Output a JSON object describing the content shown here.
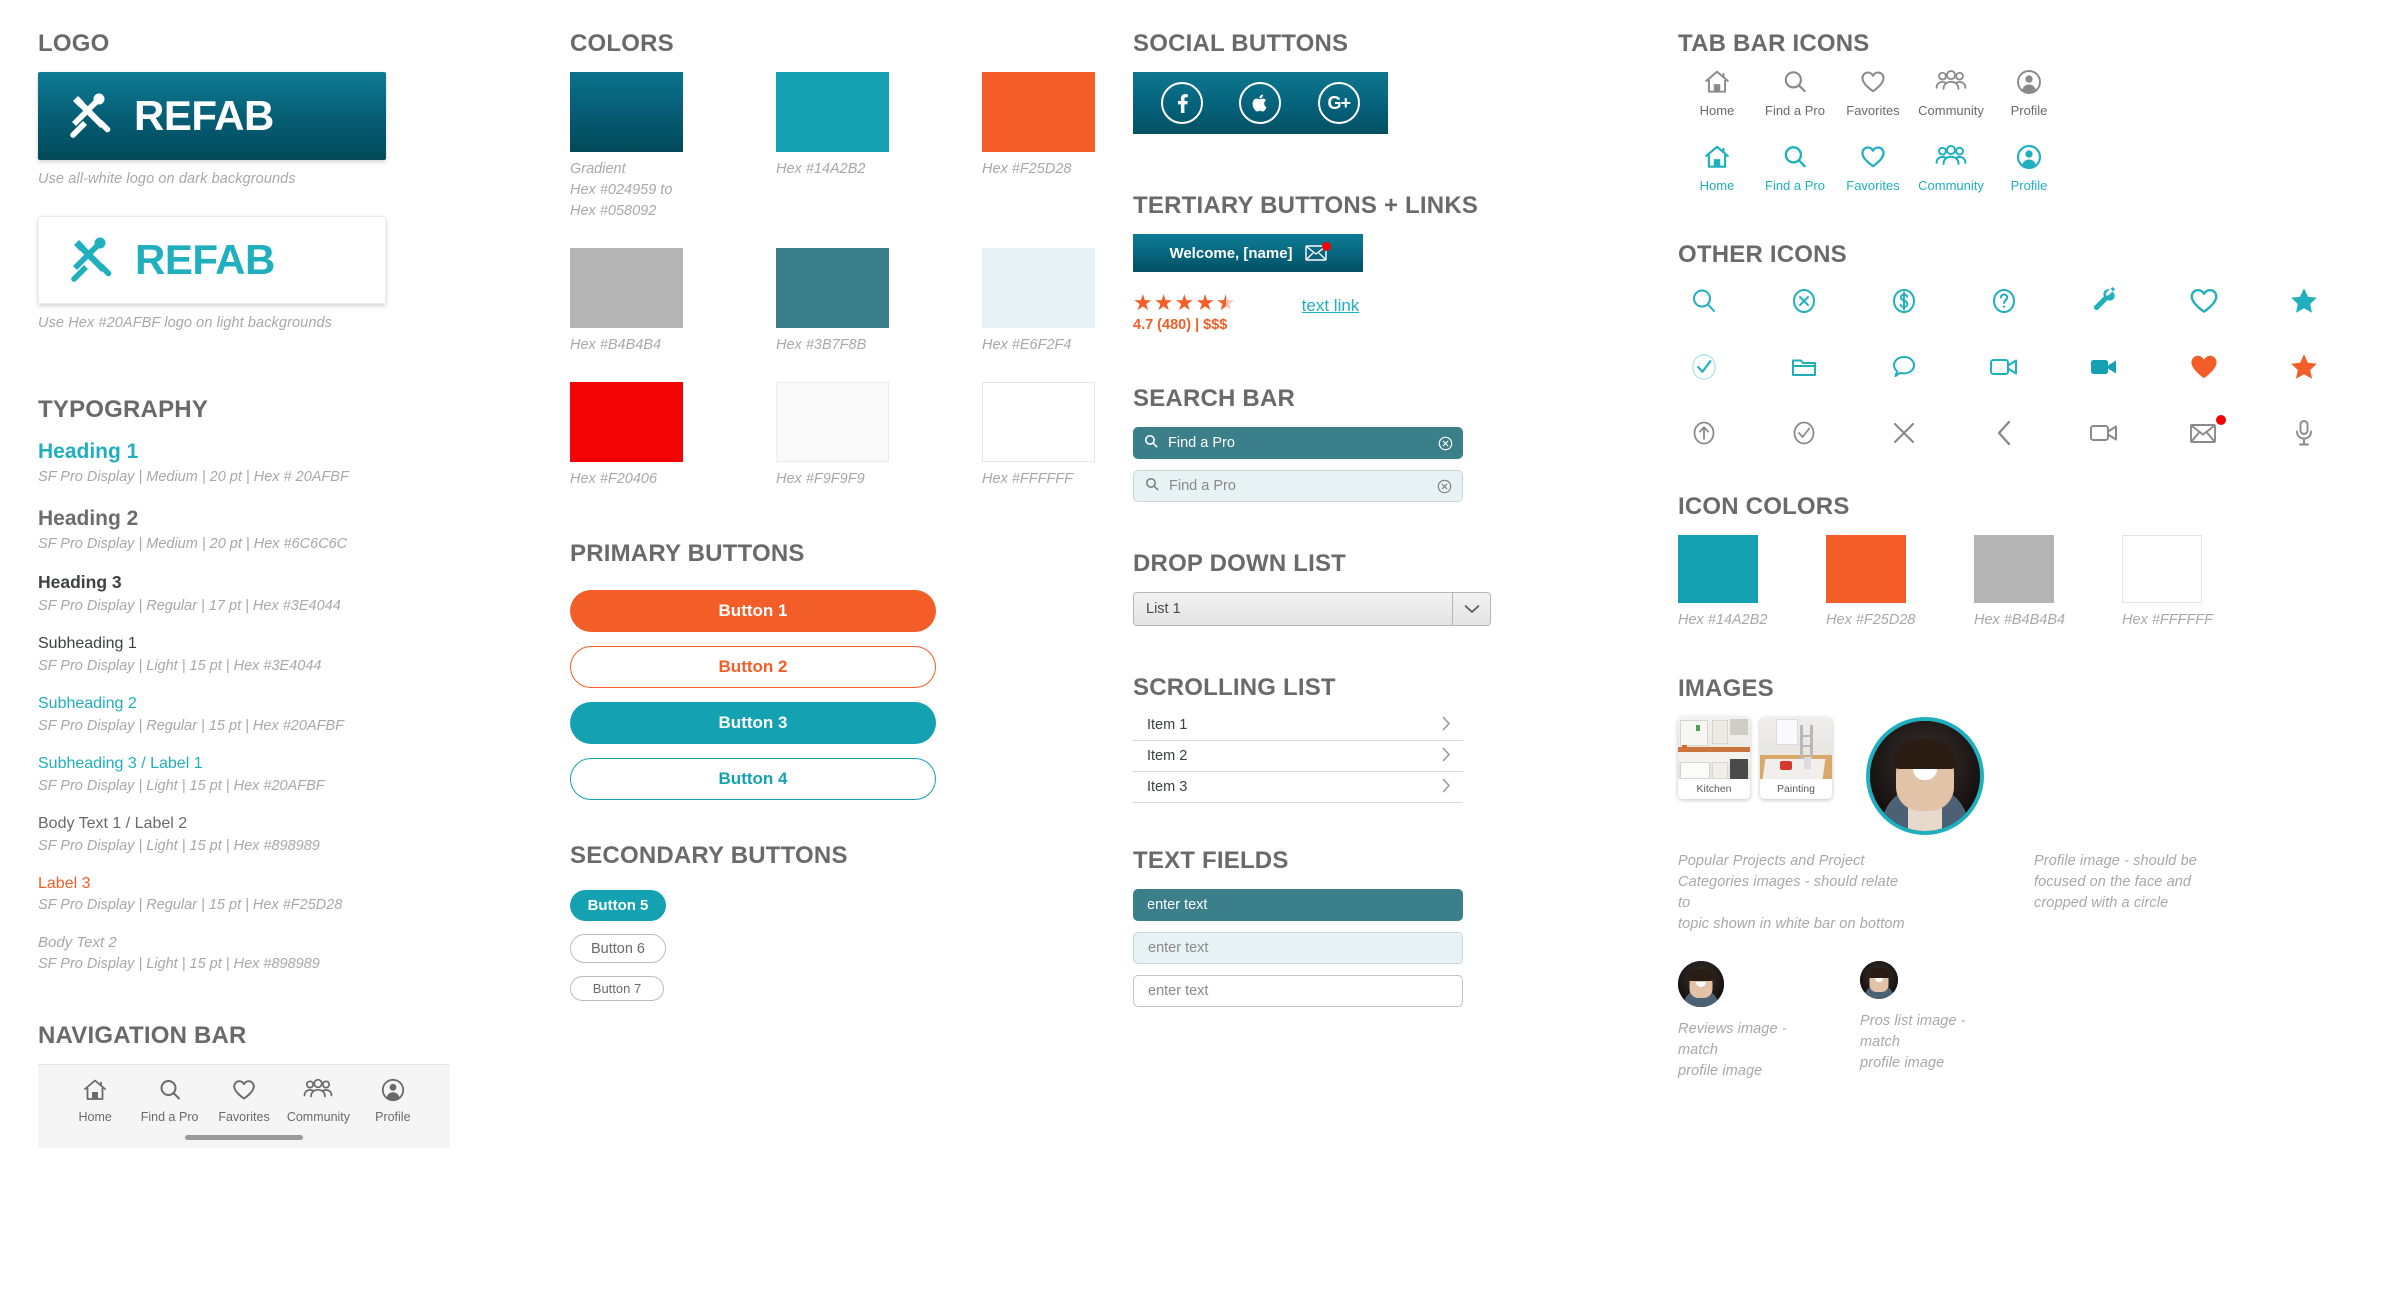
{
  "logo": {
    "title": "LOGO",
    "wordmark": "REFAB",
    "dark_caption": "Use all-white logo on dark backgrounds",
    "light_caption": "Use  Hex #20AFBF logo on light backgrounds",
    "dark_gradient_from": "#058092",
    "dark_gradient_to": "#024959",
    "light_color": "#20AFBF"
  },
  "typography": {
    "title": "TYPOGRAPHY",
    "rows": [
      {
        "name": "Heading 1",
        "spec": "SF Pro Display | Medium | 20 pt | Hex # 20AFBF",
        "color": "#20AFBF"
      },
      {
        "name": "Heading 2",
        "spec": "SF Pro Display | Medium | 20  pt | Hex #6C6C6C",
        "color": "#6C6C6C"
      },
      {
        "name": "Heading 3",
        "spec": "SF Pro Display | Regular | 17 pt | Hex #3E4044",
        "color": "#3E4044"
      },
      {
        "name": "Subheading 1",
        "spec": "SF Pro Display | Light | 15 pt | Hex #3E4044",
        "color": "#3E4044"
      },
      {
        "name": "Subheading 2",
        "spec": "SF Pro Display | Regular | 15 pt | Hex #20AFBF",
        "color": "#20AFBF"
      },
      {
        "name": "Subheading 3 / Label 1",
        "spec": "SF Pro Display | Light | 15 pt | Hex #20AFBF",
        "color": "#20AFBF"
      },
      {
        "name": "Body Text 1 / Label 2",
        "spec": "SF Pro Display | Light | 15 pt | Hex #898989",
        "color": "#898989"
      },
      {
        "name": "Label 3",
        "spec": "SF Pro Display | Regular | 15 pt | Hex #F25D28",
        "color": "#F25D28"
      },
      {
        "name": "Body Text 2",
        "spec": "SF Pro Display | Light | 15 pt | Hex #898989",
        "color": "#898989"
      }
    ]
  },
  "navigation_bar": {
    "title": "NAVIGATION BAR",
    "items": [
      {
        "label": "Home",
        "icon": "home-icon"
      },
      {
        "label": "Find a Pro",
        "icon": "search-icon"
      },
      {
        "label": "Favorites",
        "icon": "heart-icon"
      },
      {
        "label": "Community",
        "icon": "community-icon"
      },
      {
        "label": "Profile",
        "icon": "profile-icon"
      }
    ]
  },
  "colors": {
    "title": "COLORS",
    "swatches": [
      {
        "label": "Gradient\nHex #024959 to\nHex #058092",
        "hex": "gradient",
        "from": "#058092",
        "to": "#024959"
      },
      {
        "label": "Hex #14A2B2",
        "hex": "#14A2B2"
      },
      {
        "label": "Hex #F25D28",
        "hex": "#F25D28"
      },
      {
        "label": "Hex #B4B4B4",
        "hex": "#B4B4B4"
      },
      {
        "label": "Hex #3B7F8B",
        "hex": "#3B7F8B"
      },
      {
        "label": "Hex #E6F2F4",
        "hex": "#E6F2F4"
      },
      {
        "label": "Hex #F20406",
        "hex": "#F20406"
      },
      {
        "label": "Hex #F9F9F9",
        "hex": "#F9F9F9"
      },
      {
        "label": "Hex #FFFFFF",
        "hex": "#FFFFFF"
      }
    ]
  },
  "primary_buttons": {
    "title": "PRIMARY BUTTONS",
    "buttons": [
      {
        "label": "Button 1",
        "style": "filled-orange"
      },
      {
        "label": "Button 2",
        "style": "outline-orange"
      },
      {
        "label": "Button 3",
        "style": "filled-teal"
      },
      {
        "label": "Button 4",
        "style": "outline-teal"
      }
    ]
  },
  "secondary_buttons": {
    "title": "SECONDARY BUTTONS",
    "buttons": [
      {
        "label": "Button 5",
        "style": "filled-teal-sm"
      },
      {
        "label": "Button 6",
        "style": "outline-grey-md"
      },
      {
        "label": "Button 7",
        "style": "outline-grey-sm"
      }
    ]
  },
  "social_buttons": {
    "title": "SOCIAL BUTTONS",
    "items": [
      {
        "icon": "facebook-icon",
        "label": "f"
      },
      {
        "icon": "apple-icon",
        "label": ""
      },
      {
        "icon": "google-plus-icon",
        "label": "G+"
      }
    ]
  },
  "tertiary": {
    "title": "TERTIARY BUTTONS + LINKS",
    "welcome_label": "Welcome, [name]",
    "mail_icon": "envelope-icon",
    "rating_value": "4.7 (480)  |  $$$",
    "stars_filled": 4,
    "stars_half": 1,
    "link_label": "text link"
  },
  "search_bar": {
    "title": "SEARCH BAR",
    "fields": [
      {
        "placeholder": "Find a Pro",
        "style": "dark"
      },
      {
        "placeholder": "Find a Pro",
        "style": "light"
      }
    ]
  },
  "dropdown": {
    "title": "DROP DOWN LIST",
    "selected": "List 1"
  },
  "scrolling_list": {
    "title": "SCROLLING LIST",
    "items": [
      "Item 1",
      "Item 2",
      "Item 3"
    ]
  },
  "text_fields": {
    "title": "TEXT FIELDS",
    "fields": [
      {
        "placeholder": "enter text",
        "style": "dark"
      },
      {
        "placeholder": "enter text",
        "style": "light"
      },
      {
        "placeholder": "enter text",
        "style": "white"
      }
    ]
  },
  "tab_bar_icons": {
    "title": "TAB BAR ICONS",
    "grey_row": [
      {
        "label": "Home",
        "icon": "home-icon"
      },
      {
        "label": "Find a Pro",
        "icon": "search-icon"
      },
      {
        "label": "Favorites",
        "icon": "heart-icon"
      },
      {
        "label": "Community",
        "icon": "community-icon"
      },
      {
        "label": "Profile",
        "icon": "profile-icon"
      }
    ],
    "teal_row": [
      {
        "label": "Home",
        "icon": "home-icon"
      },
      {
        "label": "Find a Pro",
        "icon": "search-icon"
      },
      {
        "label": "Favorites",
        "icon": "heart-icon"
      },
      {
        "label": "Community",
        "icon": "community-icon"
      },
      {
        "label": "Profile",
        "icon": "profile-icon"
      }
    ],
    "grey_color": "#8a8a8a",
    "teal_color": "#20AFBF"
  },
  "other_icons": {
    "title": "OTHER ICONS",
    "rows": [
      [
        {
          "icon": "search-icon",
          "color": "#20AFBF"
        },
        {
          "icon": "x-circle-icon",
          "color": "#20AFBF"
        },
        {
          "icon": "dollar-circle-icon",
          "color": "#20AFBF"
        },
        {
          "icon": "question-circle-icon",
          "color": "#20AFBF"
        },
        {
          "icon": "wrench-icon",
          "color": "#20AFBF"
        },
        {
          "icon": "heart-outline-icon",
          "color": "#20AFBF"
        },
        {
          "icon": "star-filled-icon",
          "color": "#20AFBF"
        }
      ],
      [
        {
          "icon": "check-circle-icon",
          "color": "#20AFBF"
        },
        {
          "icon": "folder-icon",
          "color": "#20AFBF"
        },
        {
          "icon": "chat-bubble-icon",
          "color": "#20AFBF"
        },
        {
          "icon": "video-outline-icon",
          "color": "#20AFBF"
        },
        {
          "icon": "video-filled-icon",
          "color": "#14A2B2"
        },
        {
          "icon": "heart-filled-icon",
          "color": "#F25D28"
        },
        {
          "icon": "star-filled-icon",
          "color": "#F25D28"
        }
      ],
      [
        {
          "icon": "arrow-up-circle-icon",
          "color": "#8a8a8a"
        },
        {
          "icon": "check-circle-icon",
          "color": "#8a8a8a"
        },
        {
          "icon": "close-x-icon",
          "color": "#8a8a8a"
        },
        {
          "icon": "chevron-left-icon",
          "color": "#8a8a8a"
        },
        {
          "icon": "video-outline-icon",
          "color": "#8a8a8a"
        },
        {
          "icon": "envelope-badge-icon",
          "color": "#8a8a8a"
        },
        {
          "icon": "microphone-icon",
          "color": "#8a8a8a"
        }
      ]
    ]
  },
  "icon_colors": {
    "title": "ICON COLORS",
    "swatches": [
      {
        "label": "Hex #14A2B2",
        "hex": "#14A2B2"
      },
      {
        "label": "Hex #F25D28",
        "hex": "#F25D28"
      },
      {
        "label": "Hex #B4B4B4",
        "hex": "#B4B4B4"
      },
      {
        "label": "Hex #FFFFFF",
        "hex": "#FFFFFF"
      }
    ]
  },
  "images": {
    "title": "IMAGES",
    "thumbs": [
      {
        "label": "Kitchen"
      },
      {
        "label": "Painting"
      }
    ],
    "thumbs_caption": "Popular Projects and Project\nCategories images - should relate to\ntopic shown in white bar on bottom",
    "profile_caption": "Profile image - should be\nfocused on the face and\ncropped with a circle",
    "reviews_caption": "Reviews image - match\nprofile image",
    "pros_caption": "Pros list image - match\nprofile image"
  }
}
